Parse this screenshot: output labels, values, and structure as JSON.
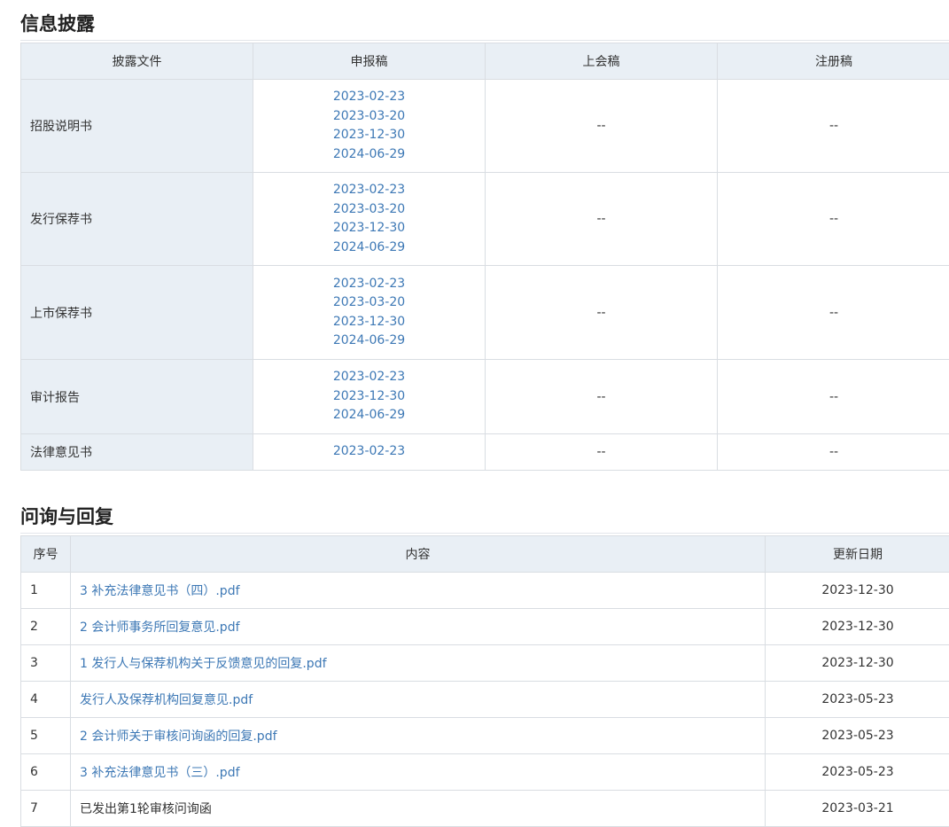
{
  "disclosure": {
    "title": "信息披露",
    "headers": [
      "披露文件",
      "申报稿",
      "上会稿",
      "注册稿"
    ],
    "rows": [
      {
        "name": "招股说明书",
        "filing_dates": [
          "2023-02-23",
          "2023-03-20",
          "2023-12-30",
          "2024-06-29"
        ],
        "meeting": "--",
        "registration": "--"
      },
      {
        "name": "发行保荐书",
        "filing_dates": [
          "2023-02-23",
          "2023-03-20",
          "2023-12-30",
          "2024-06-29"
        ],
        "meeting": "--",
        "registration": "--"
      },
      {
        "name": "上市保荐书",
        "filing_dates": [
          "2023-02-23",
          "2023-03-20",
          "2023-12-30",
          "2024-06-29"
        ],
        "meeting": "--",
        "registration": "--"
      },
      {
        "name": "审计报告",
        "filing_dates": [
          "2023-02-23",
          "2023-12-30",
          "2024-06-29"
        ],
        "meeting": "--",
        "registration": "--"
      },
      {
        "name": "法律意见书",
        "filing_dates": [
          "2023-02-23"
        ],
        "meeting": "--",
        "registration": "--"
      }
    ]
  },
  "inquiry": {
    "title": "问询与回复",
    "headers": [
      "序号",
      "内容",
      "更新日期"
    ],
    "rows": [
      {
        "seq": "1",
        "content": "3 补充法律意见书（四）.pdf",
        "is_link": true,
        "date": "2023-12-30"
      },
      {
        "seq": "2",
        "content": "2 会计师事务所回复意见.pdf",
        "is_link": true,
        "date": "2023-12-30"
      },
      {
        "seq": "3",
        "content": "1 发行人与保荐机构关于反馈意见的回复.pdf",
        "is_link": true,
        "date": "2023-12-30"
      },
      {
        "seq": "4",
        "content": "发行人及保荐机构回复意见.pdf",
        "is_link": true,
        "date": "2023-05-23"
      },
      {
        "seq": "5",
        "content": "2 会计师关于审核问询函的回复.pdf",
        "is_link": true,
        "date": "2023-05-23"
      },
      {
        "seq": "6",
        "content": "3 补充法律意见书（三）.pdf",
        "is_link": true,
        "date": "2023-05-23"
      },
      {
        "seq": "7",
        "content": "已发出第1轮审核问询函",
        "is_link": false,
        "date": "2023-03-21"
      }
    ]
  },
  "colors": {
    "link": "#3d78b5",
    "header_bg": "#e9eff5",
    "border": "#d9dde2"
  }
}
